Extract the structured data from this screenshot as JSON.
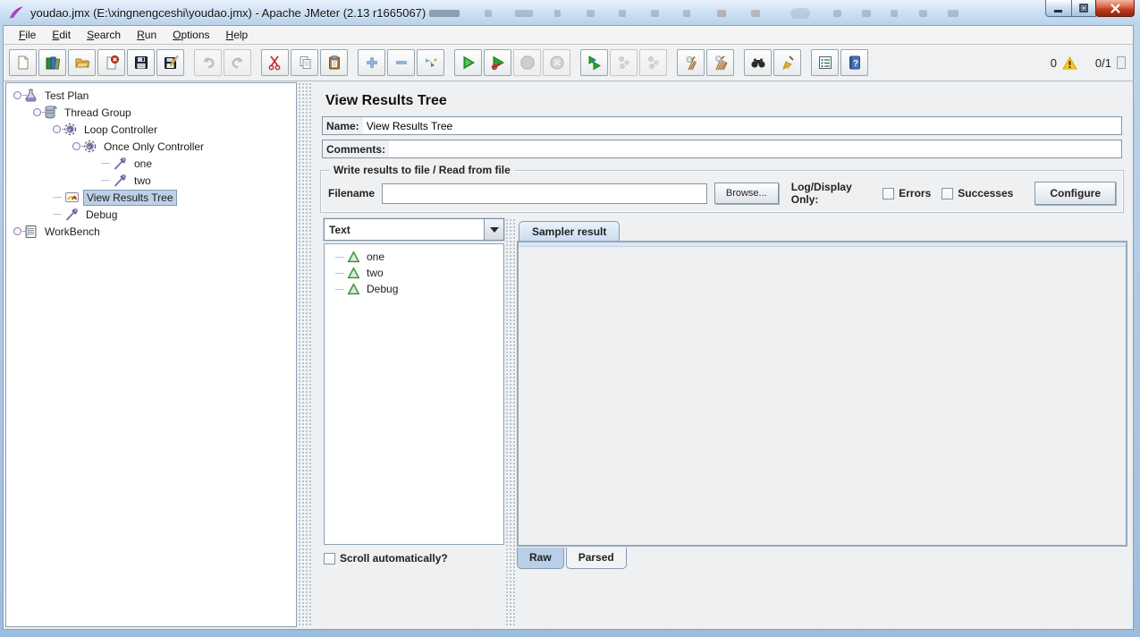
{
  "window": {
    "title": "youdao.jmx (E:\\xingnengceshi\\youdao.jmx) - Apache JMeter (2.13 r1665067)"
  },
  "menus": [
    "File",
    "Edit",
    "Search",
    "Run",
    "Options",
    "Help"
  ],
  "toolbar": {
    "icons": [
      "new-file",
      "templates",
      "open-file",
      "close-file",
      "save",
      "save-as",
      "undo",
      "redo",
      "cut",
      "copy",
      "paste",
      "expand-all",
      "collapse-all",
      "toggle",
      "start",
      "start-no-pauses",
      "stop",
      "shutdown",
      "remote-start-all",
      "remote-stop-all",
      "remote-shutdown-all",
      "clear",
      "clear-all",
      "search",
      "search-reset",
      "function-helper",
      "help"
    ],
    "warning_count": "0",
    "thread_status": "0/1"
  },
  "tree": {
    "items": [
      {
        "label": "Test Plan"
      },
      {
        "label": "Thread Group"
      },
      {
        "label": "Loop Controller"
      },
      {
        "label": "Once Only Controller"
      },
      {
        "label": "one"
      },
      {
        "label": "two"
      },
      {
        "label": "View Results Tree"
      },
      {
        "label": "Debug"
      },
      {
        "label": "WorkBench"
      }
    ]
  },
  "panel": {
    "title": "View Results Tree",
    "name_label": "Name:",
    "name_value": "View Results Tree",
    "comments_label": "Comments:",
    "comments_value": "",
    "file_group": {
      "legend": "Write results to file / Read from file",
      "filename_label": "Filename",
      "filename_value": "",
      "browse_label": "Browse...",
      "log_display_label": "Log/Display Only:",
      "errors_label": "Errors",
      "successes_label": "Successes",
      "configure_label": "Configure"
    },
    "viewer": {
      "renderer_selected": "Text",
      "results": [
        {
          "label": "one"
        },
        {
          "label": "two"
        },
        {
          "label": "Debug"
        }
      ],
      "scroll_label": "Scroll automatically?",
      "sampler_tab": "Sampler result",
      "raw_tab": "Raw",
      "parsed_tab": "Parsed"
    }
  }
}
